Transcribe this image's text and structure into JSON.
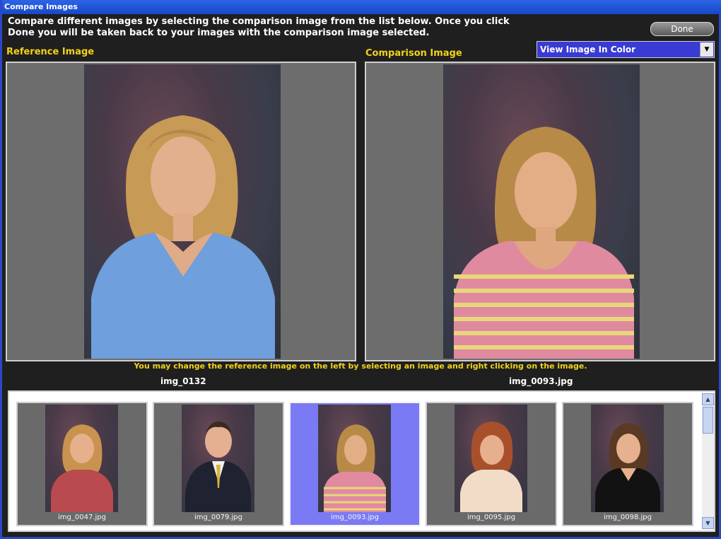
{
  "window": {
    "title": "Compare Images"
  },
  "instructions": {
    "line1": "Compare different images by selecting the comparison image from the list below. Once you click",
    "line2": "Done you will be taken back to your images with the comparison image selected."
  },
  "done_button": {
    "label": "Done"
  },
  "view_mode": {
    "selected": "View Image In Color"
  },
  "reference": {
    "label": "Reference Image",
    "filename": "img_0132"
  },
  "comparison": {
    "label": "Comparison Image",
    "filename": "img_0093.jpg"
  },
  "hint": "You may change the reference image on the left by selecting an image and right clicking on the image.",
  "thumbnails": [
    {
      "filename": "img_0047.jpg",
      "selected": false
    },
    {
      "filename": "img_0079.jpg",
      "selected": false
    },
    {
      "filename": "img_0093.jpg",
      "selected": true
    },
    {
      "filename": "img_0095.jpg",
      "selected": false
    },
    {
      "filename": "img_0098.jpg",
      "selected": false
    }
  ],
  "colors": {
    "accent_yellow": "#f2d21a",
    "selection_blue": "#7a7af5",
    "titlebar_blue": "#2d64e6"
  },
  "icons": {
    "dropdown": "chevron-down-icon",
    "scroll_up": "arrow-up-icon",
    "scroll_down": "arrow-down-icon"
  }
}
